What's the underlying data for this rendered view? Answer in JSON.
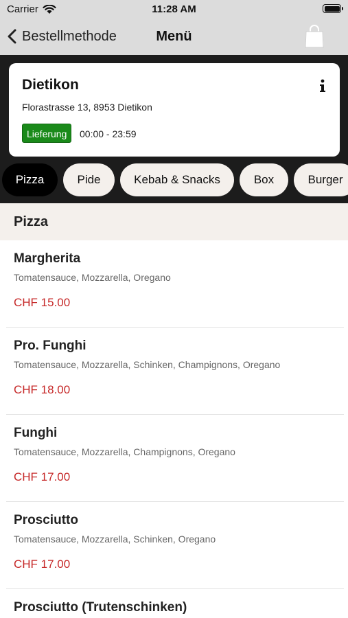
{
  "status_bar": {
    "carrier": "Carrier",
    "time": "11:28 AM"
  },
  "nav": {
    "back_label": "Bestellmethode",
    "title": "Menü"
  },
  "store": {
    "name": "Dietikon",
    "address": "Florastrasse 13, 8953 Dietikon",
    "delivery_badge": "Lieferung",
    "hours": "00:00 - 23:59"
  },
  "tabs": [
    {
      "label": "Pizza",
      "active": true
    },
    {
      "label": "Pide",
      "active": false
    },
    {
      "label": "Kebab & Snacks",
      "active": false
    },
    {
      "label": "Box",
      "active": false
    },
    {
      "label": "Burger",
      "active": false
    }
  ],
  "section": {
    "title": "Pizza"
  },
  "items": [
    {
      "name": "Margherita",
      "description": "Tomatensauce, Mozzarella, Oregano",
      "price": "CHF 15.00"
    },
    {
      "name": "Pro. Funghi",
      "description": "Tomatensauce, Mozzarella, Schinken, Champignons, Oregano",
      "price": "CHF 18.00"
    },
    {
      "name": "Funghi",
      "description": "Tomatensauce, Mozzarella, Champignons, Oregano",
      "price": "CHF 17.00"
    },
    {
      "name": "Prosciutto",
      "description": "Tomatensauce, Mozzarella, Schinken, Oregano",
      "price": "CHF 17.00"
    },
    {
      "name": "Prosciutto (Trutenschinken)"
    }
  ],
  "colors": {
    "accent_price": "#c62828",
    "delivery_badge": "#1a8a1a",
    "active_tab": "#000000",
    "tab_bg": "#f4f0ec"
  },
  "icons": {
    "back": "chevron-left-icon",
    "cart": "shopping-bag-icon",
    "info": "info-icon",
    "wifi": "wifi-icon",
    "battery": "battery-icon"
  }
}
